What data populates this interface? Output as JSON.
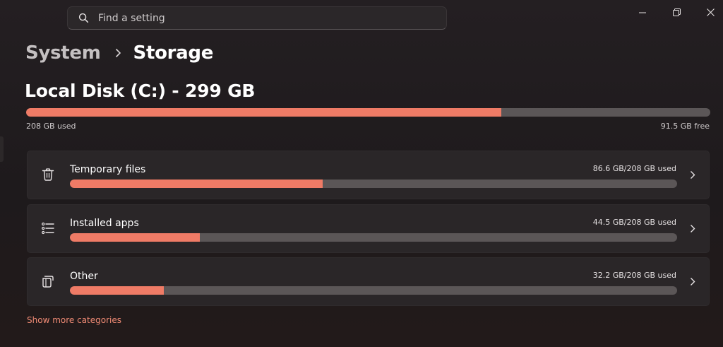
{
  "search": {
    "placeholder": "Find a setting",
    "icon": "search-icon"
  },
  "window_controls": [
    "minimize-icon",
    "restore-icon",
    "close-icon"
  ],
  "breadcrumb": {
    "parent": "System",
    "current": "Storage"
  },
  "disk": {
    "title": "Local Disk (C:) - 299 GB",
    "used_label": "208 GB used",
    "free_label": "91.5 GB free",
    "used_fraction": 0.695
  },
  "categories": [
    {
      "label": "Temporary files",
      "usage": "86.6 GB/208 GB used",
      "fraction": 0.416,
      "icon": "trash-icon"
    },
    {
      "label": "Installed apps",
      "usage": "44.5 GB/208 GB used",
      "fraction": 0.214,
      "icon": "app-list-icon"
    },
    {
      "label": "Other",
      "usage": "32.2 GB/208 GB used",
      "fraction": 0.155,
      "icon": "other-files-icon"
    }
  ],
  "more_link": "Show more categories",
  "colors": {
    "accent": "#ef7b66",
    "track": "#5b5657",
    "card": "#2a2628",
    "link": "#ef8a74"
  }
}
